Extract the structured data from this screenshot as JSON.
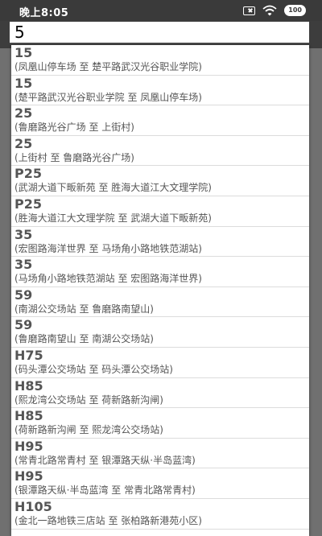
{
  "status_bar": {
    "time": "晚上8:05",
    "icons": [
      "sim-off-icon",
      "wifi-icon",
      "battery-icon"
    ],
    "battery_level": "100"
  },
  "search": {
    "value": "5"
  },
  "results": [
    {
      "route": "15",
      "desc": "(凤凰山停车场 至 楚平路武汉光谷职业学院)"
    },
    {
      "route": "15",
      "desc": "(楚平路武汉光谷职业学院 至 凤凰山停车场)"
    },
    {
      "route": "25",
      "desc": "(鲁磨路光谷广场 至 上街村)"
    },
    {
      "route": "25",
      "desc": "(上街村 至 鲁磨路光谷广场)"
    },
    {
      "route": "P25",
      "desc": "(武湖大道下畈新苑 至 胜海大道江大文理学院)"
    },
    {
      "route": "P25",
      "desc": "(胜海大道江大文理学院 至 武湖大道下畈新苑)"
    },
    {
      "route": "35",
      "desc": "(宏图路海洋世界 至 马场角小路地铁范湖站)"
    },
    {
      "route": "35",
      "desc": "(马场角小路地铁范湖站 至 宏图路海洋世界)"
    },
    {
      "route": "59",
      "desc": "(南湖公交场站 至 鲁磨路南望山)"
    },
    {
      "route": "59",
      "desc": "(鲁磨路南望山 至 南湖公交场站)"
    },
    {
      "route": "H75",
      "desc": "(码头潭公交场站 至 码头潭公交场站)"
    },
    {
      "route": "H85",
      "desc": "(熙龙湾公交场站 至 荷新路新沟闸)"
    },
    {
      "route": "H85",
      "desc": "(荷新路新沟闸 至 熙龙湾公交场站)"
    },
    {
      "route": "H95",
      "desc": "(常青北路常青村 至 银潭路天纵·半岛蓝湾)"
    },
    {
      "route": "H95",
      "desc": "(银潭路天纵·半岛蓝湾 至 常青北路常青村)"
    },
    {
      "route": "H105",
      "desc": "(金北一路地铁三店站 至 张柏路新港苑小区)"
    }
  ]
}
